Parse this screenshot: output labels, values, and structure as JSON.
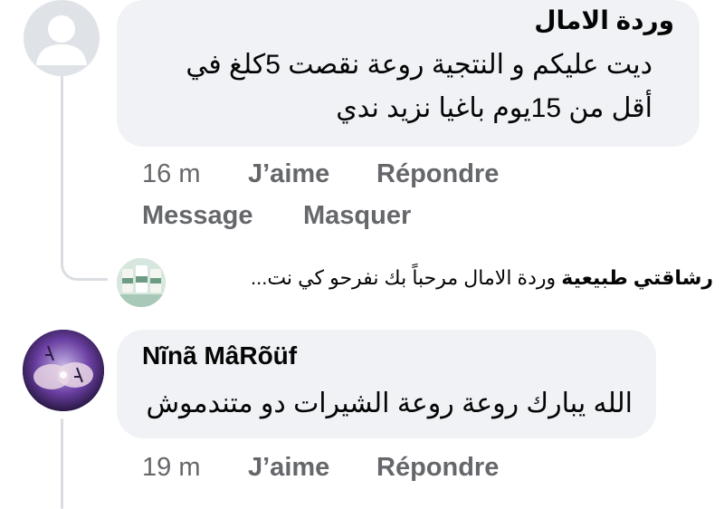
{
  "comments": [
    {
      "author": "وردة الامال",
      "text": "ديت عليكم و النتجية روعة نقصت 5كلغ في أقل من 15يوم باغيا نزيد ندي",
      "time": "16 m",
      "like": "J’aime",
      "reply": "Répondre",
      "message": "Message",
      "hide": "Masquer"
    },
    {
      "author": "Nĩnã MâRõüf",
      "text": "الله يبارك روعة روعة الشيرات دو متندموش",
      "time": "19 m",
      "like": "J’aime",
      "reply": "Répondre"
    }
  ],
  "reply_preview": {
    "author": "رشاقتي طبيعية",
    "text": "وردة الامال مرحباً بك نفرحو كي نت..."
  },
  "colors": {
    "bubble": "#f0f2f5",
    "secondary_text": "#65676b",
    "thread_line": "#dadde1"
  }
}
